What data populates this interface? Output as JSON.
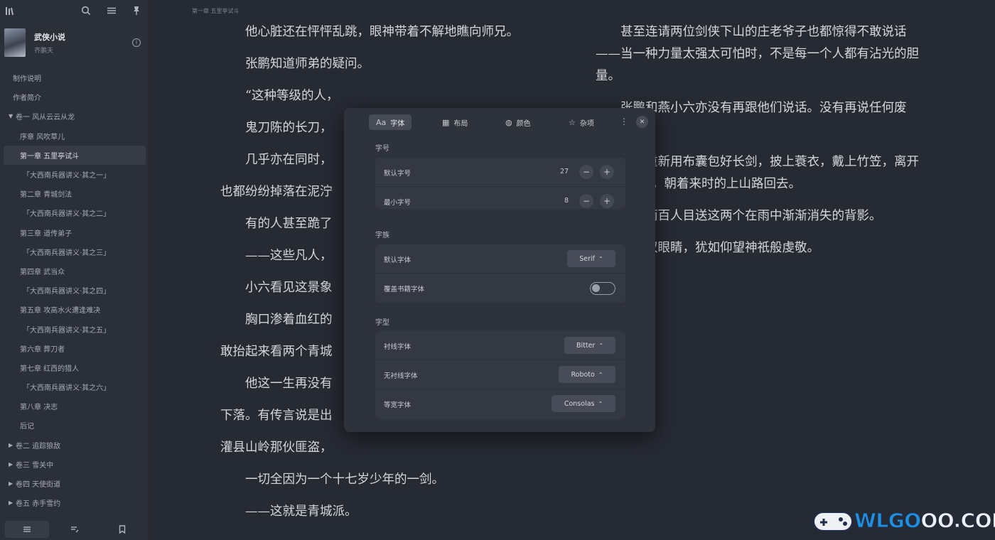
{
  "sidebar": {
    "toolbar_icons": [
      "library-icon",
      "search-icon",
      "menu-icon",
      "pin-icon"
    ],
    "book": {
      "title": "武侠小说",
      "author": "齐鹏天"
    },
    "toc": [
      {
        "label": "制作说明",
        "level": 0,
        "arrow": false
      },
      {
        "label": "作者简介",
        "level": 0,
        "arrow": false
      },
      {
        "label": "卷一 风从云云从龙",
        "level": 0,
        "arrow": true
      },
      {
        "label": "序章 风吹草儿",
        "level": 1
      },
      {
        "label": "第一章 五里亭试斗",
        "level": 1,
        "active": true
      },
      {
        "label": "「大西南兵器讲义·其之一」",
        "level": 2
      },
      {
        "label": "第二章 青城剑法",
        "level": 1
      },
      {
        "label": "「大西南兵器讲义·其之二」",
        "level": 2
      },
      {
        "label": "第三章 道传弟子",
        "level": 1
      },
      {
        "label": "「大西南兵器讲义·其之三」",
        "level": 2
      },
      {
        "label": "第四章 武当众",
        "level": 1
      },
      {
        "label": "「大西南兵器讲义·其之四」",
        "level": 2
      },
      {
        "label": "第五章 攻高水火遭逢难决",
        "level": 1
      },
      {
        "label": "「大西南兵器讲义·其之五」",
        "level": 2
      },
      {
        "label": "第六章 葬刀者",
        "level": 1
      },
      {
        "label": "第七章 红西的猎人",
        "level": 1
      },
      {
        "label": "「大西南兵器讲义·其之六」",
        "level": 2
      },
      {
        "label": "第八章 决志",
        "level": 1
      },
      {
        "label": "后记",
        "level": 1
      },
      {
        "label": "卷二 追踪狼敌",
        "level": 0,
        "arrow": true
      },
      {
        "label": "卷三 雪关中",
        "level": 0,
        "arrow": true
      },
      {
        "label": "卷四 天使街道",
        "level": 0,
        "arrow": true
      },
      {
        "label": "卷五 赤手雪约",
        "level": 0,
        "arrow": true
      }
    ],
    "bottom_tabs": [
      "toc-tab",
      "annotations-tab",
      "bookmarks-tab"
    ]
  },
  "reader": {
    "chapter_header": "第一章 五里亭试斗",
    "col1": [
      {
        "text": "他心脏还在怦怦乱跳，眼神带着不解地瞧向师兄。",
        "indent": true
      },
      {
        "text": "张鹏知道师弟的疑问。",
        "indent": true
      },
      {
        "text": "“这种等级的人，",
        "indent": true
      },
      {
        "text": "鬼刀陈的长刀，",
        "indent": true
      },
      {
        "text": "几乎亦在同时，",
        "indent": true
      },
      {
        "text": "也都纷纷掉落在泥泞",
        "indent": false
      },
      {
        "text": "有的人甚至跪了",
        "indent": true
      },
      {
        "text": "——这些凡人，",
        "indent": true
      },
      {
        "text": "小六看见这景象",
        "indent": true
      },
      {
        "text": "胸口渗着血红的",
        "indent": true
      },
      {
        "text": "敢抬起来看两个青城",
        "indent": false
      },
      {
        "text": "他这一生再没有",
        "indent": true
      },
      {
        "text": "下落。有传言说是出",
        "indent": false
      },
      {
        "text": "灌县山岭那伙匪盗，",
        "indent": false
      },
      {
        "text": "一切全因为一个十七岁少年的一剑。",
        "indent": true
      },
      {
        "text": "——这就是青城派。",
        "indent": true
      }
    ],
    "col2": [
      {
        "text": "甚至连请两位剑侠下山的庄老爷子也都惊得不敢说话——当一种力量太强太可怕时，不是每一个人都有沾光的胆量。",
        "indent": true
      },
      {
        "text": "张鹏和燕小六亦没有再跟他们说话。没有再说任何废话。",
        "indent": true
      },
      {
        "text": "他们重新用布囊包好长剑，披上蓑衣，戴上竹笠，离开五里望亭”，朝着来时的上山路回去。",
        "indent": true
      },
      {
        "text": "另外两百人目送这两个在雨中渐渐消失的背影。",
        "indent": true
      },
      {
        "text": "他们双眼睛，犹如仰望神祇般虔敬。",
        "indent": true
      }
    ]
  },
  "settings": {
    "tabs": [
      {
        "label": "字体",
        "icon": "font-icon",
        "active": true
      },
      {
        "label": "布局",
        "icon": "layout-icon",
        "active": false
      },
      {
        "label": "颜色",
        "icon": "palette-icon",
        "active": false
      },
      {
        "label": "杂项",
        "icon": "misc-icon",
        "active": false
      }
    ],
    "font_size": {
      "title": "字号",
      "default_label": "默认字号",
      "default_value": "27",
      "min_label": "最小字号",
      "min_value": "8"
    },
    "font_face": {
      "title": "字族",
      "default_font_label": "默认字体",
      "default_font_value": "Serif",
      "override_label": "覆盖书籍字体",
      "override_on": false
    },
    "font_type": {
      "title": "字型",
      "serif_label": "衬线字体",
      "serif_value": "Bitter",
      "sans_label": "无衬线字体",
      "sans_value": "Roboto",
      "mono_label": "等宽字体",
      "mono_value": "Consolas"
    }
  },
  "watermark": {
    "prefix": "WLGO",
    "suffix": "OO.COM"
  }
}
